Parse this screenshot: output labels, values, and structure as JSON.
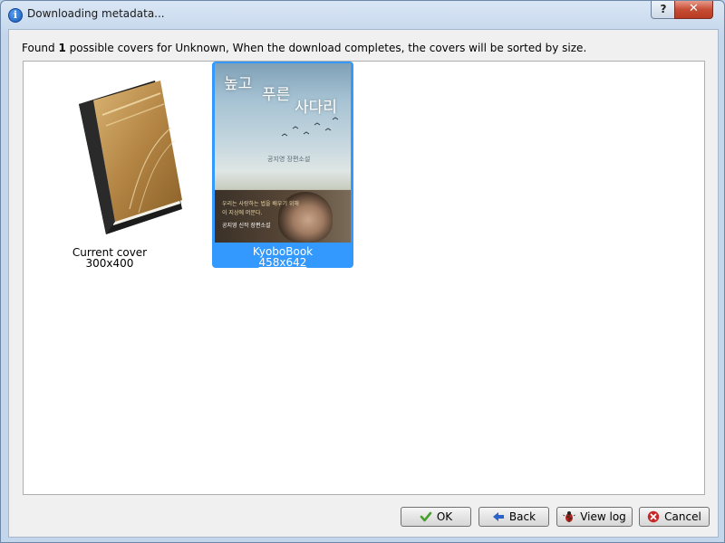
{
  "window": {
    "title": "Downloading metadata...",
    "help_label": "?",
    "close_label": "✕"
  },
  "message": {
    "prefix": "Found ",
    "count": "1",
    "suffix": " possible covers for Unknown, When the download completes, the covers will be sorted by size."
  },
  "covers": [
    {
      "name": "Current cover",
      "size": "300x400",
      "selected": false
    },
    {
      "name": "KyoboBook",
      "size": "458x642",
      "selected": true
    }
  ],
  "poster": {
    "title_line1": "높고",
    "title_line2": "푸른",
    "title_line3": "사다리",
    "subtitle": "공지영 장편소설",
    "band_line1": "우리는 사랑하는 법을 배우기 위해",
    "band_line2": "이 지상에 머문다.",
    "band_line3": "공지영 신작 장편소설"
  },
  "buttons": {
    "ok": "OK",
    "back": "Back",
    "view_log": "View log",
    "cancel": "Cancel"
  },
  "colors": {
    "selection": "#3399ff",
    "ok_icon": "#4aa02c",
    "back_icon": "#2a63c9",
    "cancel_icon": "#c62828"
  }
}
